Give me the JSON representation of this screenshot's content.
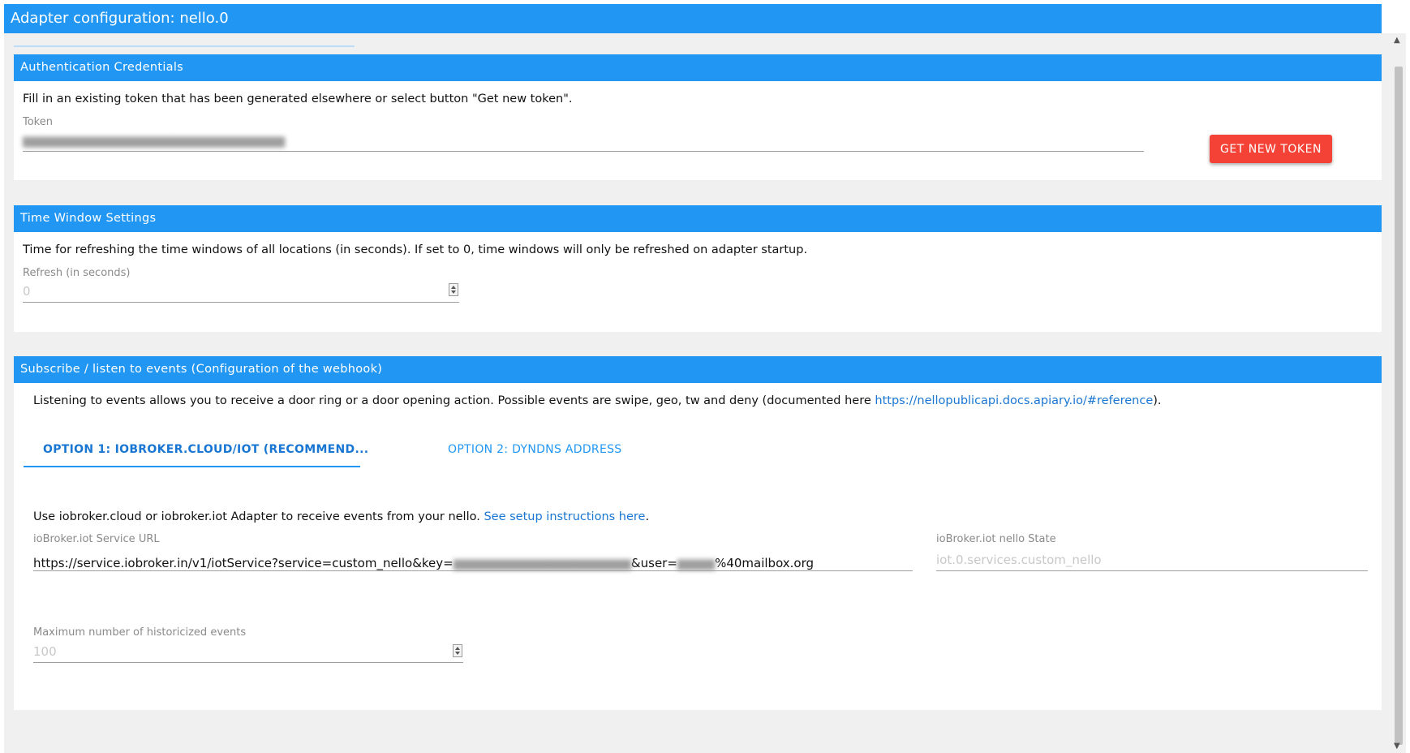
{
  "window": {
    "title": "Adapter configuration: nello.0"
  },
  "auth": {
    "header": "Authentication Credentials",
    "description": "Fill in an existing token that has been generated elsewhere or select button \"Get new token\".",
    "token_label": "Token",
    "token_value": "",
    "button_label": "GET NEW TOKEN"
  },
  "timewindow": {
    "header": "Time Window Settings",
    "description": "Time for refreshing the time windows of all locations (in seconds). If set to 0, time windows will only be refreshed on adapter startup.",
    "refresh_label": "Refresh (in seconds)",
    "refresh_placeholder": "0"
  },
  "events": {
    "header": "Subscribe / listen to events (Configuration of the webhook)",
    "description_prefix": "Listening to events allows you to receive a door ring or a door opening action. Possible events are swipe, geo, tw and deny (documented here ",
    "description_link": "https://nellopublicapi.docs.apiary.io/#reference",
    "description_suffix": ").",
    "tabs": [
      {
        "label": "OPTION 1: IOBROKER.CLOUD/IOT (RECOMMEND...",
        "active": true
      },
      {
        "label": "OPTION 2: DYNDNS ADDRESS",
        "active": false
      }
    ],
    "option1": {
      "description_prefix": "Use iobroker.cloud or iobroker.iot Adapter to receive events from your nello. ",
      "description_link": "See setup instructions here",
      "description_suffix": ".",
      "url_label": "ioBroker.iot Service URL",
      "url_part1": "https://service.iobroker.in/v1/iotService?service=custom_nello&key=",
      "url_part2": "&user=",
      "url_part3": "%40mailbox.org",
      "state_label": "ioBroker.iot nello State",
      "state_placeholder": "iot.0.services.custom_nello",
      "max_label": "Maximum number of historicized events",
      "max_placeholder": "100"
    }
  },
  "colors": {
    "primary": "#2196f3",
    "accent_button": "#f44336",
    "background": "#f0f0f0"
  }
}
